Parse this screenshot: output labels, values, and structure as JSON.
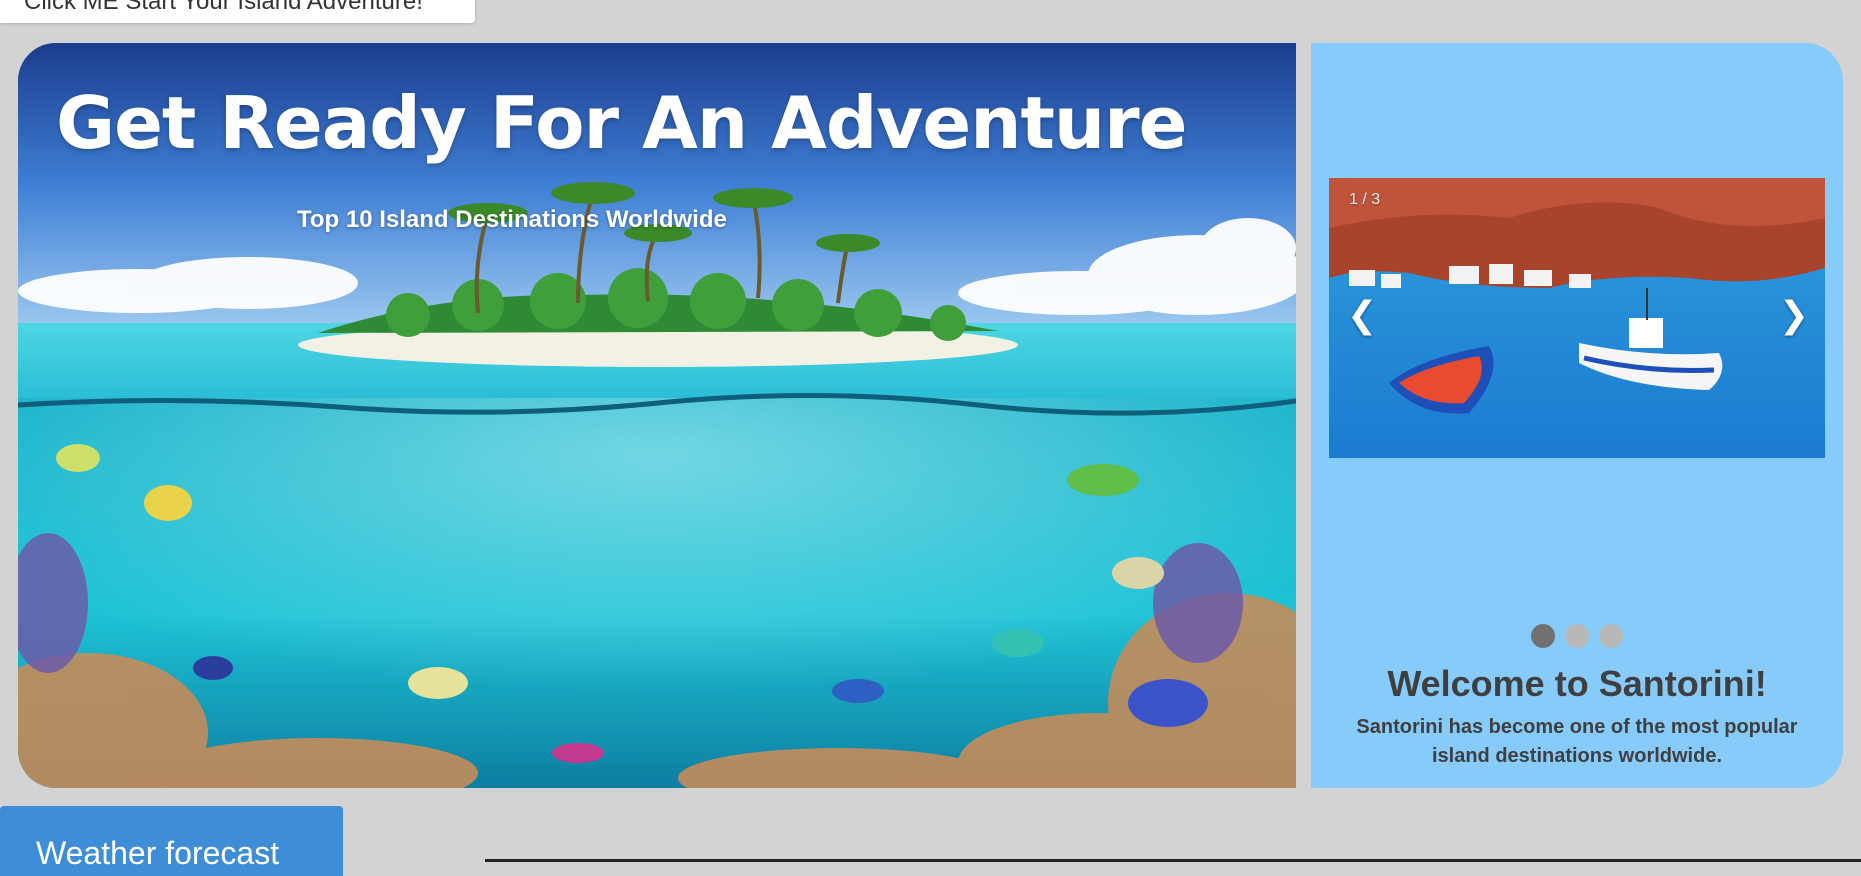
{
  "top_cta": {
    "label": "Click ME Start Your Island Adventure!"
  },
  "hero": {
    "title": "Get Ready For An Adventure",
    "subtitle": "Top 10 Island Destinations Worldwide",
    "image": "tropical-island-underwater-reef"
  },
  "slideshow": {
    "counter": "1 / 3",
    "prev_label": "❮",
    "next_label": "❯",
    "current_slide": 1,
    "total_slides": 3,
    "image": "santorini-harbor-boats",
    "heading": "Welcome to Santorini!",
    "text": "Santorini has become one of the most popular island destinations worldwide."
  },
  "weather_button": {
    "label": "Weather forecast"
  },
  "colors": {
    "page_bg": "#d3d3d3",
    "panel_bg": "#87cbfa",
    "button_bg": "#3d8ed6",
    "dot_active": "#717171",
    "dot_inactive": "#b8b8b8",
    "heading_text": "#3f3f3f"
  }
}
